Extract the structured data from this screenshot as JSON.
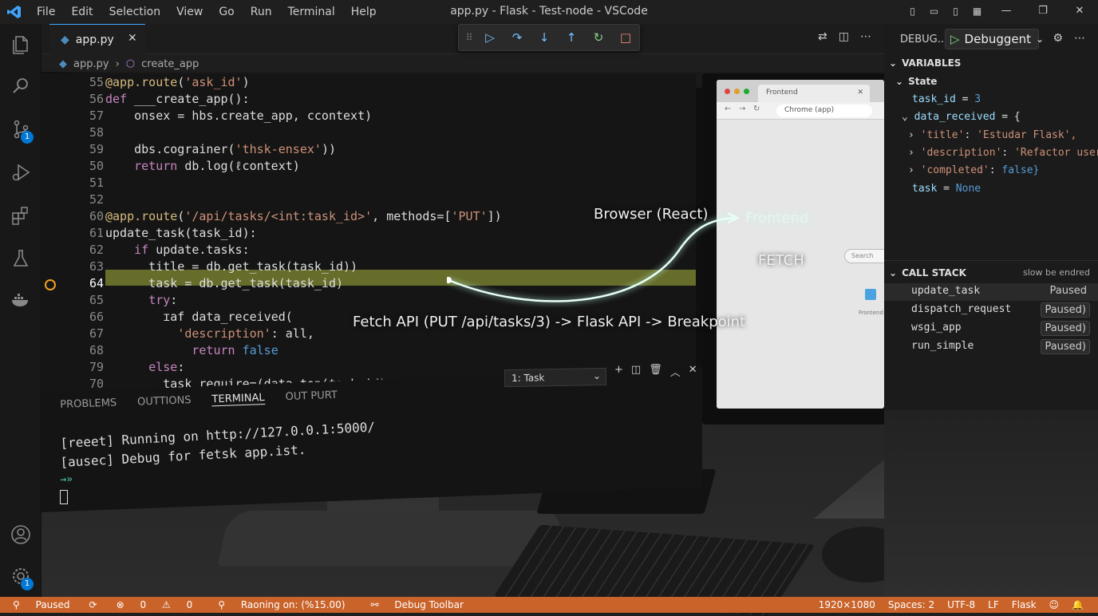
{
  "window": {
    "title": "app.py - Flask - Test-node - VSCode"
  },
  "menu": [
    "File",
    "Edit",
    "Selection",
    "View",
    "Go",
    "Run",
    "Terminal",
    "Help"
  ],
  "tab": {
    "label": "app.py"
  },
  "breadcrumb": {
    "file": "app.py",
    "symbol": "create_app"
  },
  "debug_toolbar": [
    "continue",
    "step-over",
    "step-into",
    "step-out",
    "restart",
    "stop"
  ],
  "activity_badges": {
    "scm": "1",
    "settings": "1"
  },
  "code": [
    {
      "n": "55",
      "t": "@app.route('ask_id')"
    },
    {
      "n": "56",
      "t": "def ___create_app():"
    },
    {
      "n": "57",
      "t": "    onsex = hbs.create_app, ccontext)"
    },
    {
      "n": "58",
      "t": ""
    },
    {
      "n": "59",
      "t": "    dbs.cograiner('thsk-ensex'))"
    },
    {
      "n": "50",
      "t": "    return db.log(ℓcontext)"
    },
    {
      "n": "51",
      "t": ""
    },
    {
      "n": "52",
      "t": ""
    },
    {
      "n": "60",
      "t": "@app.route('/api/tasks/<int:task_id>', methods=['PUT'])"
    },
    {
      "n": "61",
      "t": "update_task(task_id):"
    },
    {
      "n": "62",
      "t": "    if update.tasks:"
    },
    {
      "n": "63",
      "t": "      title = db.get_task(task_id))"
    },
    {
      "n": "64",
      "t": "      task = db.get_task(task_id)"
    },
    {
      "n": "65",
      "t": "      try:"
    },
    {
      "n": "66",
      "t": "        ɪaf data_received("
    },
    {
      "n": "67",
      "t": "          'description': all,"
    },
    {
      "n": "68",
      "t": "            return false"
    },
    {
      "n": "79",
      "t": "      else:"
    },
    {
      "n": "70",
      "t": "        task require=(data top(task id)"
    }
  ],
  "panel": {
    "tabs": [
      "PROBLEMS",
      "OUTTIONS",
      "TERMINAL",
      "OUT PURT"
    ],
    "terminal_select": "1: Task",
    "lines": [
      "[reeet] Running on http://127.0.0.1:5000/",
      "[ausec] Debug for fetsk app.ist.",
      "→»"
    ]
  },
  "browser": {
    "tab": "Frontend",
    "url": "Chrome (app)",
    "search": "Search",
    "item": "Frontend"
  },
  "overlay": {
    "browser_label": "Browser (React)",
    "frontend": "Frontend",
    "fetch": "FETCH",
    "flow": "Fetch API (PUT /api/tasks/3) -> Flask API -> Breakpoint"
  },
  "sidebar": {
    "title": "DEBUG...",
    "config": "Debuggent",
    "variables_header": "VARIABLES",
    "scope": "State",
    "vars": {
      "task_id_key": "task_id",
      "task_id_val": "3",
      "data_key": "data_received",
      "data_val": "= {",
      "title_key": "'title'",
      "title_val": "'Estudar Flask',",
      "desc_key": "'description'",
      "desc_val": "'Refactor user a",
      "done_key": "'completed'",
      "done_val": "false}",
      "task_key": "task",
      "task_val": "None"
    },
    "callstack_header": "CALL STACK",
    "callstack_note": "slow be endred",
    "frames": [
      {
        "name": "update_task",
        "state": "Paused"
      },
      {
        "name": "dispatch_request",
        "state": "Paused)"
      },
      {
        "name": "wsgi_app",
        "state": "Paused)"
      },
      {
        "name": "run_simple",
        "state": "Paused)"
      }
    ]
  },
  "status": {
    "mode": "Paused",
    "errors": "0",
    "warnings": "0",
    "running": "Raoning on: (%15.00)",
    "toolbar": "Debug Toolbar",
    "resolution": "1920×1080",
    "spaces": "Spaces: 2",
    "encoding": "UTF-8",
    "eol": "LF",
    "lang": "Flask"
  },
  "colors": {
    "status_bg": "#c9632a",
    "accent": "#3ea6ff",
    "highlight": "#aab43c"
  }
}
